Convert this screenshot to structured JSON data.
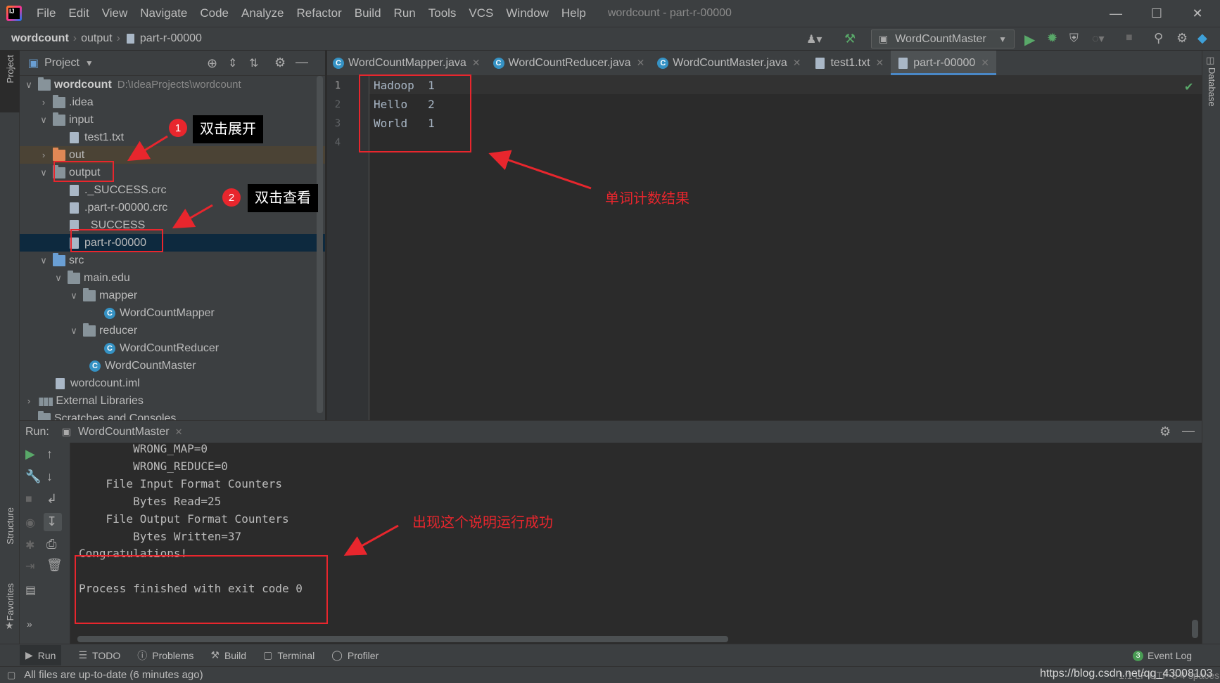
{
  "menubar": {
    "items": [
      "File",
      "Edit",
      "View",
      "Navigate",
      "Code",
      "Analyze",
      "Refactor",
      "Build",
      "Run",
      "Tools",
      "VCS",
      "Window",
      "Help"
    ],
    "title": "wordcount - part-r-00000"
  },
  "breadcrumb": [
    "wordcount",
    "output",
    "part-r-00000"
  ],
  "run_config": "WordCountMaster",
  "project_panel": {
    "title": "Project",
    "tree": [
      {
        "label": "wordcount",
        "path": "D:\\IdeaProjects\\wordcount"
      },
      {
        "label": ".idea"
      },
      {
        "label": "input"
      },
      {
        "label": "test1.txt"
      },
      {
        "label": "out"
      },
      {
        "label": "output"
      },
      {
        "label": "._SUCCESS.crc"
      },
      {
        "label": ".part-r-00000.crc"
      },
      {
        "label": "_SUCCESS"
      },
      {
        "label": "part-r-00000"
      },
      {
        "label": "src"
      },
      {
        "label": "main.edu"
      },
      {
        "label": "mapper"
      },
      {
        "label": "WordCountMapper"
      },
      {
        "label": "reducer"
      },
      {
        "label": "WordCountReducer"
      },
      {
        "label": "WordCountMaster"
      },
      {
        "label": "wordcount.iml"
      },
      {
        "label": "External Libraries"
      },
      {
        "label": "Scratches and Consoles"
      }
    ]
  },
  "editor_tabs": [
    "WordCountMapper.java",
    "WordCountReducer.java",
    "WordCountMaster.java",
    "test1.txt",
    "part-r-00000"
  ],
  "editor": {
    "line_numbers": [
      "1",
      "2",
      "3",
      "4"
    ],
    "lines": [
      "Hadoop\t1",
      "Hello\t2",
      "World\t1",
      ""
    ]
  },
  "run_panel": {
    "label": "Run:",
    "tab": "WordCountMaster",
    "console": [
      "\t\tWRONG_MAP=0",
      "\t\tWRONG_REDUCE=0",
      "\tFile Input Format Counters ",
      "\t\tBytes Read=25",
      "\tFile Output Format Counters ",
      "\t\tBytes Written=37",
      "Congratulations!",
      "",
      "Process finished with exit code 0"
    ]
  },
  "bottom_tools": [
    "Run",
    "TODO",
    "Problems",
    "Build",
    "Terminal",
    "Profiler"
  ],
  "event_log": {
    "count": "3",
    "label": "Event Log"
  },
  "status": {
    "message": "All files are up-to-date (6 minutes ago)",
    "right": "1:1  LF  UTF-8  4 spaces",
    "watermark": "https://blog.csdn.net/qq_43008103"
  },
  "side_labels": {
    "project": "Project",
    "structure": "Structure",
    "favorites": "Favorites",
    "database": "Database"
  },
  "annotations": {
    "badge1": "1",
    "callout1": "双击展开",
    "badge2": "2",
    "callout2": "双击查看",
    "result_note": "单词计数结果",
    "success_note": "出现这个说明运行成功"
  },
  "colors": {
    "annotation_red": "#e8262d",
    "selection": "#0d293e",
    "accent_blue": "#4a88c7"
  }
}
